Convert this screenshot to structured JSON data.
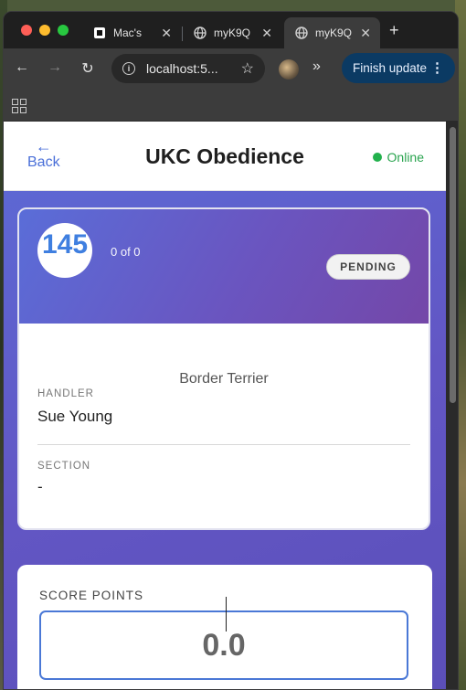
{
  "browser": {
    "tabs": [
      {
        "title": "Mac's",
        "icon": "app-favicon"
      },
      {
        "title": "myK9Q",
        "icon": "globe-icon"
      },
      {
        "title": "myK9Q",
        "icon": "globe-icon",
        "active": true
      }
    ],
    "url": "localhost:5...",
    "finish_update_label": "Finish update"
  },
  "header": {
    "back_arrow": "←",
    "back_label": "Back",
    "title": "UKC Obedience",
    "status": "Online"
  },
  "entry": {
    "armband": "145",
    "counter": "0 of 0",
    "status": "PENDING",
    "breed": "Border Terrier",
    "handler_label": "HANDLER",
    "handler": "Sue Young",
    "section_label": "SECTION",
    "section": "-"
  },
  "score": {
    "label": "SCORE POINTS",
    "value": "0.0"
  },
  "colors": {
    "accent": "#4a6fd8",
    "online": "#22b14c",
    "gradient_start": "#5a6dd8",
    "gradient_end": "#7447a8"
  }
}
